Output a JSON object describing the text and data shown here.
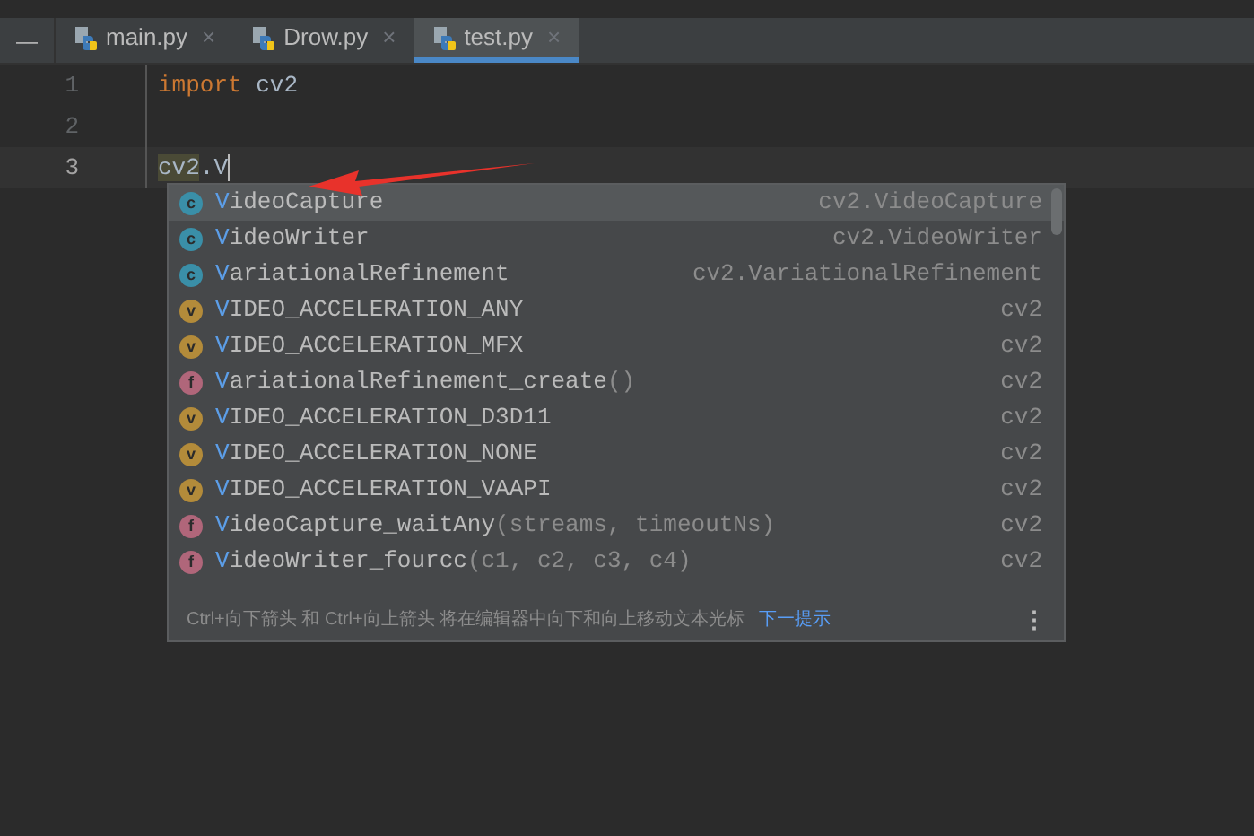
{
  "tool_strip": {
    "collapse_glyph": "—"
  },
  "tabs": [
    {
      "label": "main.py",
      "close": "×",
      "selected": false
    },
    {
      "label": "Drow.py",
      "close": "×",
      "selected": false
    },
    {
      "label": "test.py",
      "close": "×",
      "selected": true
    }
  ],
  "editor": {
    "lines": [
      {
        "number": "1",
        "current": false,
        "tokens": [
          {
            "kind": "keyword",
            "text": "import"
          },
          {
            "kind": "plain",
            "text": " cv2"
          }
        ]
      },
      {
        "number": "2",
        "current": false
      },
      {
        "number": "3",
        "current": true,
        "tokens": [
          {
            "kind": "highlight",
            "text": "cv2"
          },
          {
            "kind": "plain",
            "text": ".V"
          }
        ]
      }
    ]
  },
  "completion": {
    "items": [
      {
        "kind": "class",
        "icon": "c",
        "match": "V",
        "rest": "ideoCapture",
        "type": "cv2.VideoCapture",
        "selected": true
      },
      {
        "kind": "class",
        "icon": "c",
        "match": "V",
        "rest": "ideoWriter",
        "type": "cv2.VideoWriter",
        "selected": false
      },
      {
        "kind": "class",
        "icon": "c",
        "match": "V",
        "rest": "ariationalRefinement",
        "type": "cv2.VariationalRefinement",
        "selected": false
      },
      {
        "kind": "variable",
        "icon": "v",
        "match": "V",
        "rest": "IDEO_ACCELERATION_ANY",
        "type": "cv2",
        "selected": false
      },
      {
        "kind": "variable",
        "icon": "v",
        "match": "V",
        "rest": "IDEO_ACCELERATION_MFX",
        "type": "cv2",
        "selected": false
      },
      {
        "kind": "function",
        "icon": "f",
        "match": "V",
        "rest": "ariationalRefinement_create",
        "params": "()",
        "type": "cv2",
        "selected": false
      },
      {
        "kind": "variable",
        "icon": "v",
        "match": "V",
        "rest": "IDEO_ACCELERATION_D3D11",
        "type": "cv2",
        "selected": false
      },
      {
        "kind": "variable",
        "icon": "v",
        "match": "V",
        "rest": "IDEO_ACCELERATION_NONE",
        "type": "cv2",
        "selected": false
      },
      {
        "kind": "variable",
        "icon": "v",
        "match": "V",
        "rest": "IDEO_ACCELERATION_VAAPI",
        "type": "cv2",
        "selected": false
      },
      {
        "kind": "function",
        "icon": "f",
        "match": "V",
        "rest": "ideoCapture_waitAny",
        "params": "(streams, timeoutNs)",
        "type": "cv2",
        "selected": false
      },
      {
        "kind": "function",
        "icon": "f",
        "match": "V",
        "rest": "ideoWriter_fourcc",
        "params": "(c1, c2, c3, c4)",
        "type": "cv2",
        "selected": false
      }
    ],
    "hint": "Ctrl+向下箭头 和 Ctrl+向上箭头 将在编辑器中向下和向上移动文本光标",
    "hint_link": "下一提示",
    "menu_glyph": "⋮"
  }
}
